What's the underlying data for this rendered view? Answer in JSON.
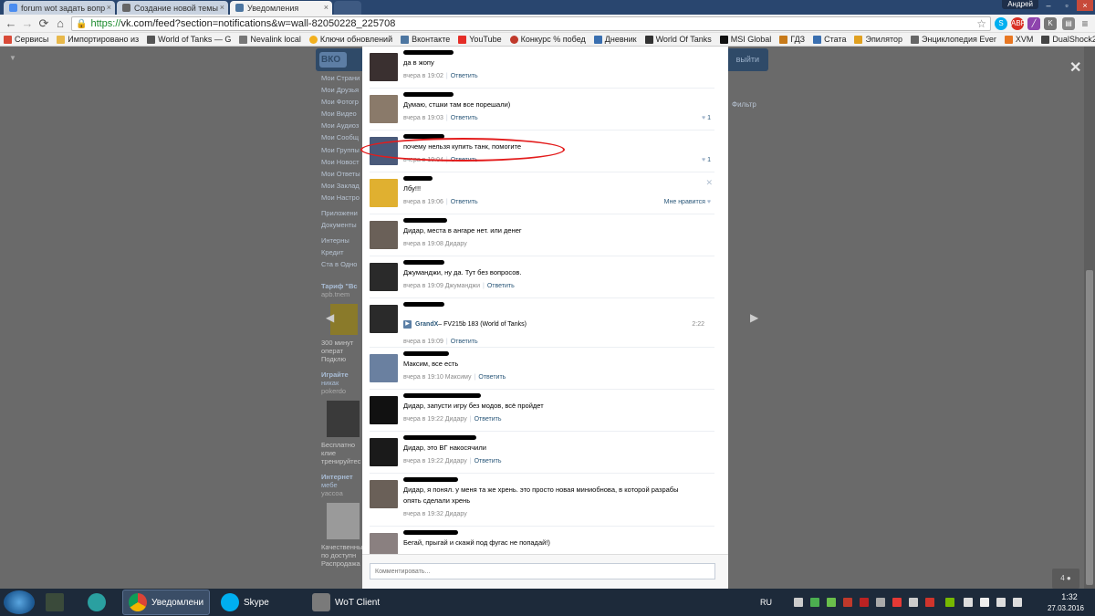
{
  "browser": {
    "tabs": [
      {
        "title": "forum wot задать вопр",
        "icon_color": "#4a8cf0"
      },
      {
        "title": "Создание новой темы",
        "icon_color": "#666666"
      },
      {
        "title": "Уведомления",
        "icon_color": "#4d76a1"
      }
    ],
    "user_name": "Андрей",
    "url_https": "https://",
    "url_rest": "vk.com/feed?section=notifications&w=wall-82050228_225708"
  },
  "bookmarks": [
    {
      "label": "Сервисы",
      "color": "#d94a38"
    },
    {
      "label": "Импортировано из",
      "color": "#e8b84a"
    },
    {
      "label": "World of Tanks — G",
      "color": "#555555"
    },
    {
      "label": "Nevalink local",
      "color": "#777777"
    },
    {
      "label": "Ключи обновлений",
      "color": "#f2b01e"
    },
    {
      "label": "Вконтакте",
      "color": "#4d76a1"
    },
    {
      "label": "YouTube",
      "color": "#e52d27"
    },
    {
      "label": "Конкурс % побед",
      "color": "#c0392b"
    },
    {
      "label": "Дневник",
      "color": "#3a6fb0"
    },
    {
      "label": "World Of Tanks",
      "color": "#333333"
    },
    {
      "label": "MSI Global",
      "color": "#111111"
    },
    {
      "label": "ГДЗ",
      "color": "#c77a1a"
    },
    {
      "label": "Стата",
      "color": "#3a6fb0"
    },
    {
      "label": "Эпилятор",
      "color": "#e0a020"
    },
    {
      "label": "Энциклопедия Ever",
      "color": "#666666"
    },
    {
      "label": "XVM",
      "color": "#e87722"
    },
    {
      "label": "DualShock2",
      "color": "#444444"
    }
  ],
  "left_menu": [
    "Мои Страни",
    "Мои Друзья",
    "Мои Фотогр",
    "Мои Видео",
    "Мои Аудиоз",
    "Мои Сообщ",
    "Мои Группы",
    "Мои Новост",
    "Мои Ответы",
    "Мои Заклад",
    "Мои Настро"
  ],
  "left_menu_extra": [
    "Приложени",
    "Документы"
  ],
  "left_menu_misc": [
    "Интерны",
    "Кредит",
    "Ста в Одно"
  ],
  "left_ads": [
    "Тариф \"Вс",
    "apb.tnem",
    "300 минут",
    "операт",
    "Подклю",
    "Играйте",
    "никак",
    "pokerdo",
    "Бесплатно",
    "клие",
    "тренируйтес",
    "Интернет",
    "мебе",
    "yaccoa",
    "Качественны",
    "по доступн",
    "Распродажа"
  ],
  "page": {
    "vk_logo": "ВКО",
    "exit_label": "выйти",
    "filter_label": "Фильтр",
    "unread_count": "4"
  },
  "feed": {
    "items": [
      {
        "text": "да в жопу",
        "time": "вчера в 19:02",
        "reply": "Ответить",
        "likes": "",
        "like_label": ""
      },
      {
        "text": "Думаю, стшки там все порешали)",
        "time": "вчера в 19:03",
        "reply": "Ответить",
        "likes": "1",
        "like_label": ""
      },
      {
        "text": "почему нельзя купить танк, помогите",
        "time": "вчера в 19:04",
        "reply": "Ответить",
        "likes": "1",
        "like_label": ""
      },
      {
        "text": "Лбу!!!",
        "time": "вчера в 19:06",
        "reply": "Ответить",
        "likes": "",
        "like_label": "Мне нравится"
      },
      {
        "text": "Дидар, места в ангаре нет. или денег",
        "time": "вчера в 19:08 Дидару",
        "reply": "",
        "likes": "",
        "like_label": ""
      },
      {
        "text": "Джуманджи, ну да. Тут без вопросов.",
        "time": "вчера в 19:09 Джуманджи",
        "reply": "Ответить",
        "likes": "",
        "like_label": ""
      },
      {
        "text": "",
        "time": "вчера в 19:09",
        "reply": "Ответить",
        "likes": "",
        "like_label": "",
        "video_author": "GrandX",
        "video_title": " – FV215b 183 (World of Tanks)",
        "video_duration": "2:22"
      },
      {
        "text": "Максим, все есть",
        "time": "вчера в 19:10 Максиму",
        "reply": "Ответить",
        "likes": "",
        "like_label": ""
      },
      {
        "text": "Дидар, запусти игру без модов, всё пройдет",
        "time": "вчера в 19:22 Дидару",
        "reply": "Ответить",
        "likes": "",
        "like_label": ""
      },
      {
        "text": "Дидар, это ВГ накосячили",
        "time": "вчера в 19:22 Дидару",
        "reply": "Ответить",
        "likes": "",
        "like_label": ""
      },
      {
        "text": "Дидар, я понял. у меня та же хрень. это просто новая миниобнова, в которой разрабы опять сделали хрень",
        "time": "вчера в 19:32 Дидару",
        "reply": "",
        "likes": "",
        "like_label": ""
      },
      {
        "text": "Бегай, прыгай и скажй под фугас не попадай!)",
        "time": "",
        "reply": "",
        "likes": "",
        "like_label": ""
      }
    ],
    "comment_placeholder": "Комментировать..."
  },
  "taskbar": {
    "apps": [
      {
        "label": "Уведомлени",
        "color": "#e0b020"
      },
      {
        "label": "Skype",
        "color": "#00aff0"
      },
      {
        "label": "WoT Client",
        "color": "#8a8a8a"
      }
    ],
    "language": "RU",
    "time": "1:32",
    "date": "27.03.2016"
  }
}
